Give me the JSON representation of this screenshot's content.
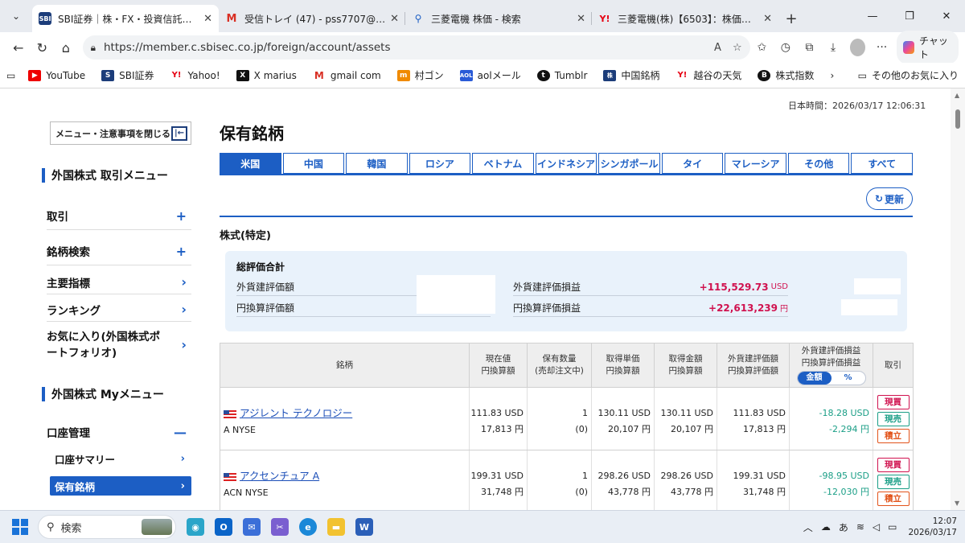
{
  "browser": {
    "tabs": [
      {
        "title": "SBI証券｜株・FX・投資信託・確定拠",
        "icon": "sbi-icon",
        "active": true
      },
      {
        "title": "受信トレイ (47) - pss7707@gmail.co",
        "icon": "gmail-icon",
        "active": false
      },
      {
        "title": "三菱電機 株価 - 検索",
        "icon": "search-icon",
        "active": false
      },
      {
        "title": "三菱電機(株)【6503】：株価・株式情",
        "icon": "yahoo-icon",
        "active": false
      }
    ],
    "url": "https://member.c.sbisec.co.jp/foreign/account/assets",
    "chat_label": "チャット",
    "bookmarks": [
      {
        "label": "YouTube",
        "icon": "youtube-icon"
      },
      {
        "label": "SBI証券",
        "icon": "sbi-icon"
      },
      {
        "label": "Yahoo!",
        "icon": "yahoo-icon"
      },
      {
        "label": "X marius",
        "icon": "x-icon"
      },
      {
        "label": "gmail com",
        "icon": "gmail-icon"
      },
      {
        "label": "村ゴン",
        "icon": "m-icon"
      },
      {
        "label": "aolメール",
        "icon": "aol-icon"
      },
      {
        "label": "Tumblr",
        "icon": "tumblr-icon"
      },
      {
        "label": "中国銘柄",
        "icon": "stock-icon"
      },
      {
        "label": "越谷の天気",
        "icon": "yahoo-icon"
      },
      {
        "label": "株式指数",
        "icon": "b-icon"
      }
    ],
    "other_bookmarks": "その他のお気に入り"
  },
  "page": {
    "jp_time": "日本時間：2026/03/17 12:06:31",
    "close_menu": "メニュー・注意事項を閉じる",
    "title": "保有銘柄",
    "refresh": "更新",
    "account_type": "株式(特定)"
  },
  "sidebar": {
    "section1": "外国株式 取引メニュー",
    "items": [
      {
        "label": "取引",
        "icon": "plus-icon"
      },
      {
        "label": "銘柄検索",
        "icon": "plus-icon"
      },
      {
        "label": "主要指標",
        "icon": "chevron-right-icon"
      },
      {
        "label": "ランキング",
        "icon": "chevron-right-icon"
      },
      {
        "label": "お気に入り(外国株式ポートフォリオ)",
        "icon": "chevron-right-icon"
      }
    ],
    "section2": "外国株式 Myメニュー",
    "account_mgmt": "口座管理",
    "subitems": [
      {
        "label": "口座サマリー",
        "active": false
      },
      {
        "label": "保有銘柄",
        "active": true
      }
    ]
  },
  "country_tabs": [
    "米国",
    "中国",
    "韓国",
    "ロシア",
    "ベトナム",
    "インドネシア",
    "シンガポール",
    "タイ",
    "マレーシア",
    "その他",
    "すべて"
  ],
  "summary": {
    "title": "総評価合計",
    "fx_value_label": "外貨建評価額",
    "jpy_value_label": "円換算評価額",
    "fx_pl_label": "外貨建評価損益",
    "fx_pl_value": "+115,529.73",
    "fx_pl_unit": "USD",
    "jpy_pl_label": "円換算評価損益",
    "jpy_pl_value": "+22,613,239",
    "jpy_pl_unit": "円"
  },
  "table": {
    "headers": {
      "name": "銘柄",
      "price": [
        "現在値",
        "円換算額"
      ],
      "qty": [
        "保有数量",
        "(売却注文中)"
      ],
      "cost": [
        "取得単価",
        "円換算額"
      ],
      "amount": [
        "取得金額",
        "円換算額"
      ],
      "value": [
        "外貨建評価額",
        "円換算評価額"
      ],
      "pl": [
        "外貨建評価損益",
        "円換算評価損益"
      ],
      "toggle": [
        "金額",
        "%"
      ],
      "trade": "取引"
    },
    "buttons": {
      "buy": "現買",
      "sell": "現売",
      "accum": "積立"
    },
    "rows": [
      {
        "name": "アジレント テクノロジー",
        "code": "A NYSE",
        "price_usd": "111.83 USD",
        "price_jpy": "17,813 円",
        "qty": "1",
        "qty_pending": "(0)",
        "cost_usd": "130.11 USD",
        "cost_jpy": "20,107 円",
        "amount_usd": "130.11 USD",
        "amount_jpy": "20,107 円",
        "value_usd": "111.83 USD",
        "value_jpy": "17,813 円",
        "pl_usd": "-18.28 USD",
        "pl_jpy": "-2,294 円"
      },
      {
        "name": "アクセンチュア A",
        "code": "ACN NYSE",
        "price_usd": "199.31 USD",
        "price_jpy": "31,748 円",
        "qty": "1",
        "qty_pending": "(0)",
        "cost_usd": "298.26 USD",
        "cost_jpy": "43,778 円",
        "amount_usd": "298.26 USD",
        "amount_jpy": "43,778 円",
        "value_usd": "199.31 USD",
        "value_jpy": "31,748 円",
        "pl_usd": "-98.95 USD",
        "pl_jpy": "-12,030 円"
      }
    ]
  },
  "taskbar": {
    "search": "検索",
    "ime": "あ",
    "time": "12:07",
    "date": "2026/03/17"
  }
}
